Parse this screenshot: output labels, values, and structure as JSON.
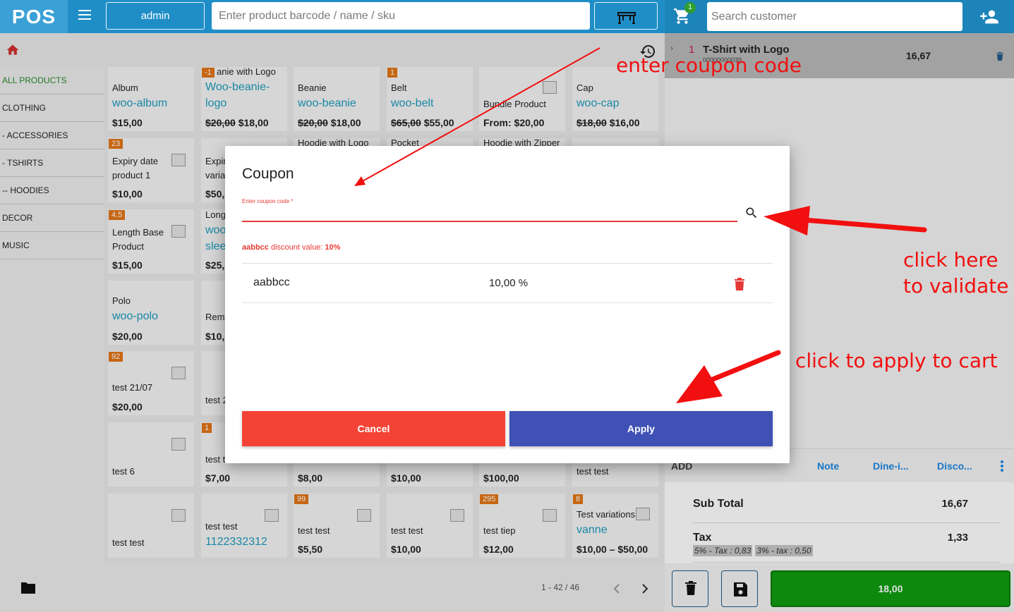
{
  "header": {
    "logo": "POS",
    "user": "admin",
    "product_search_placeholder": "Enter product barcode / name / sku",
    "cart_count": "1",
    "customer_search_placeholder": "Search customer"
  },
  "categories": [
    {
      "label": "ALL PRODUCTS"
    },
    {
      "label": "CLOTHING"
    },
    {
      "label": "- ACCESSORIES"
    },
    {
      "label": "- TSHIRTS"
    },
    {
      "label": "-- HOODIES"
    },
    {
      "label": "DECOR"
    },
    {
      "label": "MUSIC"
    }
  ],
  "products": [
    {
      "name": "Album",
      "sku": "woo-album",
      "price": "$15,00"
    },
    {
      "badge": "-1",
      "name": "anie with Logo",
      "sku": "Woo-beanie-",
      "sku2": "logo",
      "old_price": "$20,00",
      "price": "$18,00"
    },
    {
      "name": "Beanie",
      "sku": "woo-beanie",
      "old_price": "$20,00",
      "price": "$18,00"
    },
    {
      "badge": "1",
      "name": "Belt",
      "sku": "woo-belt",
      "old_price": "$65,00",
      "price": "$55,00"
    },
    {
      "name": "Bundle Product",
      "price": "From: $20,00"
    },
    {
      "name": "Cap",
      "sku": "woo-cap",
      "old_price": "$18,00",
      "price": "$16,00"
    },
    {
      "badge": "23",
      "name": "Expiry date",
      "name2": "product 1",
      "price": "$10,00"
    },
    {
      "name": "Expir",
      "name2": "varia",
      "price": "$50,"
    },
    {
      "name": "Hoodie with Logo"
    },
    {
      "name": "Pocket"
    },
    {
      "name": "Hoodie with Zipper"
    },
    {
      "badge": "4.5",
      "name": "Length Base",
      "name2": "Product",
      "price": "$15,00"
    },
    {
      "name": "Long",
      "sku": "woo",
      "sku2": "slee",
      "price": "$25,"
    },
    {
      "name": "Polo",
      "sku": "woo-polo",
      "price": "$20,00"
    },
    {
      "name": "Rem",
      "price": "$10,"
    },
    {
      "badge": "92",
      "name": "test 21/07",
      "price": "$20,00"
    },
    {
      "name": "test 2"
    },
    {
      "name": "test 6"
    },
    {
      "badge": "1",
      "name": "test t",
      "price": "$7,00"
    },
    {
      "price": "$8,00"
    },
    {
      "price": "$10,00"
    },
    {
      "price": "$100,00"
    },
    {
      "name": "test test"
    },
    {
      "name": "test test"
    },
    {
      "name": "test test",
      "sku": "1122332312"
    },
    {
      "badge": "99",
      "name": "test test",
      "price": "$5,50"
    },
    {
      "name": "test test",
      "price": "$10,00"
    },
    {
      "badge": "295",
      "name": "test tiep",
      "price": "$12,00"
    },
    {
      "badge": "8",
      "name": "Test variations",
      "sku": "vanne",
      "price": "$10,00 – $50,00"
    }
  ],
  "pagination": "1 - 42 / 46",
  "cart": {
    "items": [
      {
        "qty": "1",
        "name": "T-Shirt with Logo",
        "sku": "00000000039",
        "price": "16,67"
      }
    ],
    "tabs": {
      "add": "ADD",
      "note": "Note",
      "dine": "Dine-i...",
      "discount": "Disco..."
    },
    "subtotal_label": "Sub Total",
    "subtotal": "16,67",
    "tax_label": "Tax",
    "tax": "1,33",
    "tax_breakdown": [
      "5% - Tax : 0,83",
      "3% - tax : 0,50"
    ],
    "pay_total": "18,00"
  },
  "dialog": {
    "title": "Coupon",
    "input_label": "Enter coupon code *",
    "input_value": "",
    "message_code": "aabbcc",
    "message_text": " discount value: ",
    "message_value": "10%",
    "coupons": [
      {
        "code": "aabbcc",
        "value": "10,00 %"
      }
    ],
    "cancel_label": "Cancel",
    "apply_label": "Apply"
  },
  "annotations": {
    "enter_code": "enter coupon code",
    "validate_line1": "click here",
    "validate_line2": "to validate",
    "apply": "click to apply to cart"
  },
  "colors": {
    "header_blue": "#1f8ec7",
    "annotation_red": "#f20f0f",
    "cancel_red": "#f44336",
    "apply_indigo": "#3f51b5",
    "pay_green": "#0f9d0f",
    "sku_teal": "#1c9bbd",
    "badge_orange": "#e27515"
  }
}
